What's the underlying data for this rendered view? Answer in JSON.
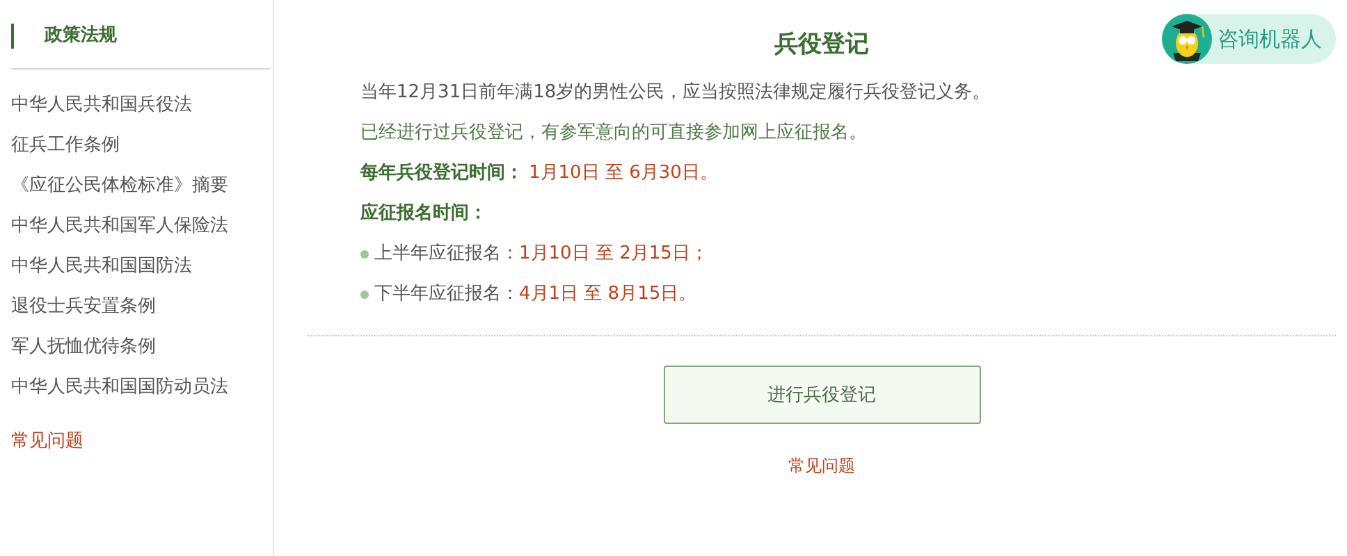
{
  "sidebar": {
    "heading": "政策法规",
    "items": [
      {
        "label": "中华人民共和国兵役法"
      },
      {
        "label": "征兵工作条例"
      },
      {
        "label": "《应征公民体检标准》摘要"
      },
      {
        "label": "中华人民共和国军人保险法"
      },
      {
        "label": "中华人民共和国国防法"
      },
      {
        "label": "退役士兵安置条例"
      },
      {
        "label": "军人抚恤优待条例"
      },
      {
        "label": "中华人民共和国国防动员法"
      }
    ],
    "faq_link": "常见问题"
  },
  "main": {
    "title": "兵役登记",
    "robot_button": "咨询机器人",
    "paragraphs": [
      {
        "kind": "plain",
        "text": "当年12月31日前年满18岁的男性公民，应当按照法律规定履行兵役登记义务。"
      },
      {
        "kind": "note",
        "text": "已经进行过兵役登记，有参军意向的可直接参加网上应征报名。"
      },
      {
        "kind": "labeled",
        "label": "每年兵役登记时间：",
        "value": "1月10日 至 6月30日。"
      },
      {
        "kind": "heading",
        "text": "应征报名时间："
      },
      {
        "kind": "bullet",
        "label": "上半年应征报名：",
        "value": "1月10日 至 2月15日；"
      },
      {
        "kind": "bullet",
        "label": "下半年应征报名：",
        "value": "4月1日 至 8月15日。"
      }
    ],
    "action_button": "进行兵役登记",
    "faq_link": "常见问题"
  }
}
